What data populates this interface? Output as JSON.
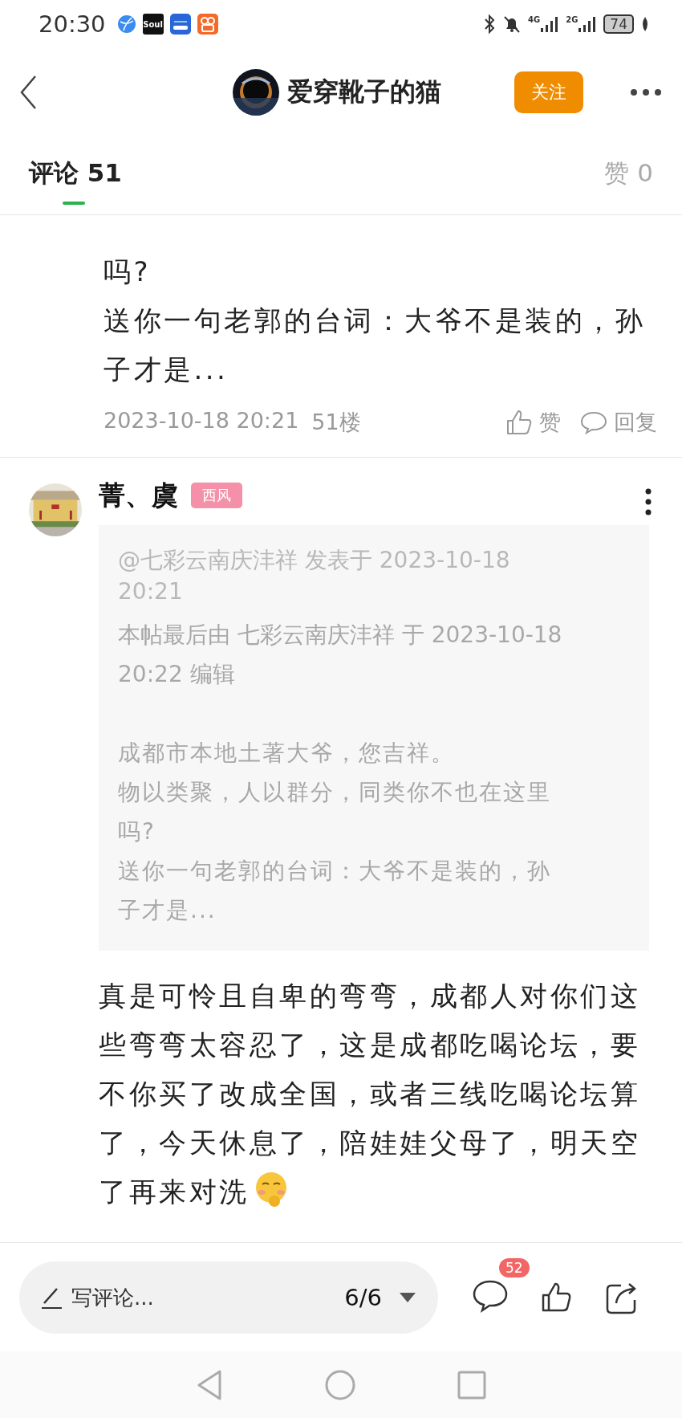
{
  "status_bar": {
    "time": "20:30",
    "apps": [
      {
        "kind": "browser"
      },
      {
        "kind": "soul",
        "label": "Soul"
      },
      {
        "kind": "car"
      },
      {
        "kind": "video"
      }
    ],
    "signals": [
      {
        "label": "4G"
      },
      {
        "label": "2G"
      }
    ],
    "battery": "74"
  },
  "header": {
    "title": "爱穿靴子的猫",
    "follow": "关注"
  },
  "tabs": [
    {
      "label": "评论",
      "count": "51",
      "selected": true
    },
    {
      "label": "赞",
      "count": "0",
      "selected": false
    }
  ],
  "comments": [
    {
      "kind": "tail",
      "paragraphs": [
        "吗?",
        "送你一句老郭的台词：大爷不是装的，孙子才是..."
      ],
      "time": "2023-10-18 20:21",
      "floor": "51楼",
      "like": "赞",
      "reply": "回复"
    },
    {
      "kind": "full",
      "author": "菁、虞",
      "tag": "西风",
      "quote": {
        "header": "@七彩云南庆沣祥 发表于 2023-10-18 20:21",
        "edit": "本帖最后由 七彩云南庆沣祥 于 2023-10-18 20:22 编辑",
        "paragraphs": [
          "成都市本地土著大爷，您吉祥。",
          "物以类聚，人以群分，同类你不也在这里吗?",
          "送你一句老郭的台词：大爷不是装的，孙子才是..."
        ]
      },
      "paragraphs": [
        "真是可怜且自卑的弯弯，成都人对你们这些弯弯太容忍了，这是成都吃喝论坛，要不你买了改成全国，或者三线吃喝论坛算了，今天休息了，陪娃娃父母了，明天空",
        "了再来对洗"
      ],
      "emoji": true
    }
  ],
  "bottom_bar": {
    "placeholder": "写评论...",
    "pager": "6/6",
    "badge": "52"
  }
}
